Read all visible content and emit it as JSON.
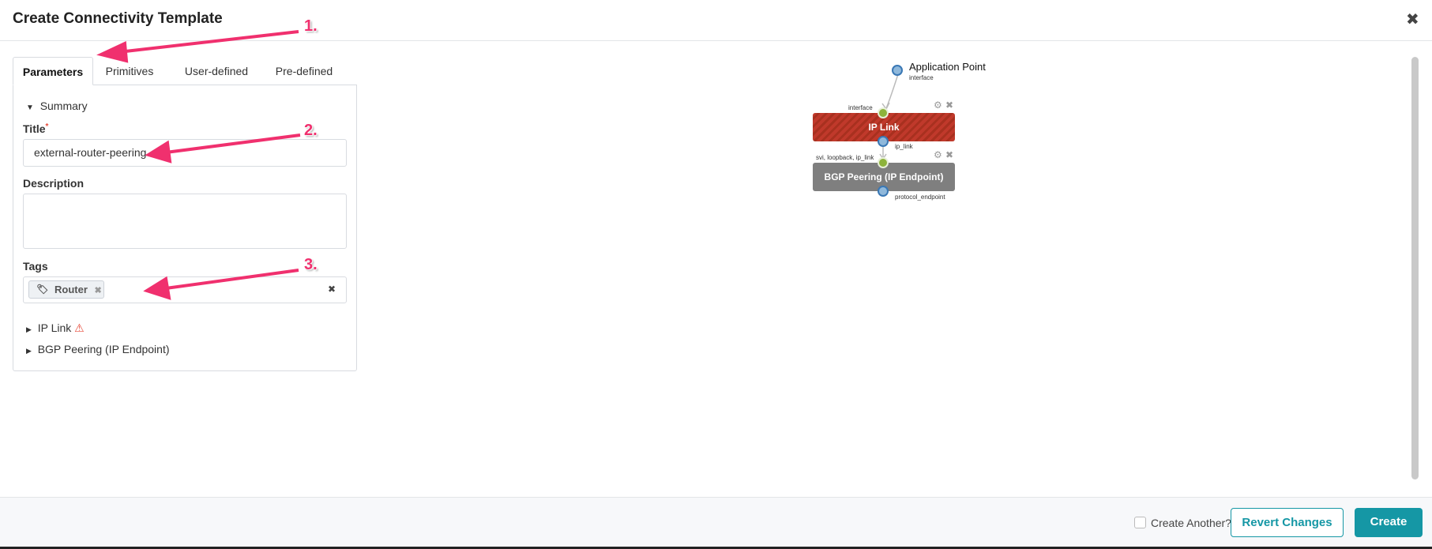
{
  "dialog": {
    "title": "Create Connectivity Template",
    "close_icon": "close-icon"
  },
  "tabs": [
    {
      "label": "Parameters",
      "active": true
    },
    {
      "label": "Primitives"
    },
    {
      "label": "User-defined"
    },
    {
      "label": "Pre-defined"
    }
  ],
  "form": {
    "summary_label": "Summary",
    "title_label": "Title",
    "required_mark": "*",
    "title_value": "external-router-peering",
    "description_label": "Description",
    "description_value": "",
    "tags_label": "Tags",
    "tags": [
      {
        "label": "Router"
      }
    ],
    "sections": [
      {
        "label": "IP Link",
        "warning": true
      },
      {
        "label": "BGP Peering (IP Endpoint)"
      }
    ]
  },
  "diagram": {
    "app_point": {
      "label": "Application Point",
      "port": "interface"
    },
    "nodes": [
      {
        "label": "IP Link",
        "in_port": "interface",
        "out_port": "ip_link",
        "color": "#c0392b",
        "striped": true
      },
      {
        "label": "BGP Peering (IP Endpoint)",
        "in_port": "svi, loopback, ip_link",
        "out_port": "protocol_endpoint",
        "color": "#7f7f7f"
      }
    ]
  },
  "annotations": [
    "1.",
    "2.",
    "3."
  ],
  "footer": {
    "create_another_label": "Create Another?",
    "create_another_checked": false,
    "revert_label": "Revert Changes",
    "create_label": "Create"
  },
  "colors": {
    "accent": "#1597a5",
    "annotation": "#f0306e",
    "warning": "#e74c3c"
  }
}
